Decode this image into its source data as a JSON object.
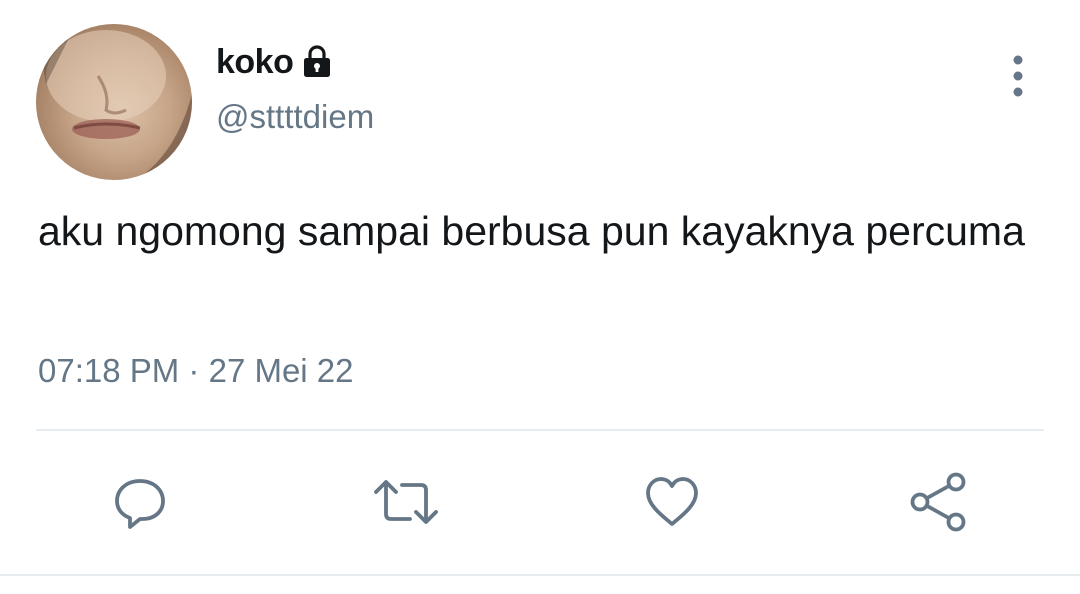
{
  "tweet": {
    "display_name": "koko",
    "handle": "@sttttdiem",
    "text": "aku ngomong sampai berbusa pun kayaknya percuma",
    "time": "07:18 PM",
    "separator": "·",
    "date": "27 Mei 22",
    "protected": true
  },
  "icons": {
    "lock": "lock-icon",
    "more": "more-vertical-icon",
    "reply": "reply-icon",
    "retweet": "retweet-icon",
    "like": "heart-icon",
    "share": "share-icon"
  },
  "colors": {
    "text_primary": "#14171a",
    "text_secondary": "#657786",
    "divider": "#e6ecf0",
    "icon": "#657786"
  }
}
